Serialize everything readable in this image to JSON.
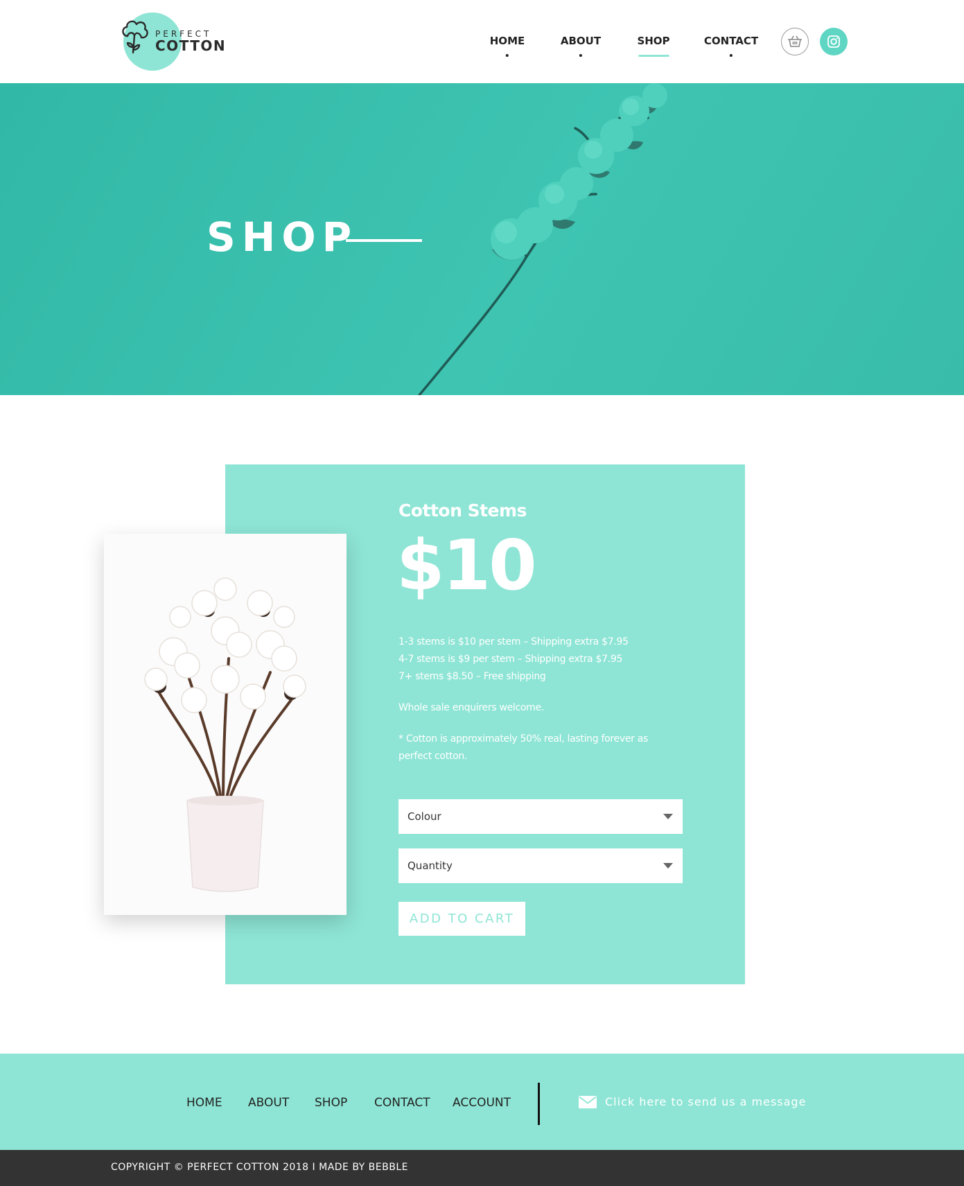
{
  "brand": {
    "name_top": "PERFECT",
    "name_bottom": "COTTON"
  },
  "nav": {
    "items": [
      {
        "label": "HOME"
      },
      {
        "label": "ABOUT"
      },
      {
        "label": "SHOP"
      },
      {
        "label": "CONTACT"
      }
    ],
    "active": "SHOP",
    "cart_icon": "basket-icon",
    "social_icon": "instagram-icon"
  },
  "hero": {
    "title": "SHOP"
  },
  "product": {
    "name": "Cotton Stems",
    "price": "$10",
    "pricing_lines": [
      "1-3 stems is $10 per stem – Shipping extra $7.95",
      "4-7 stems is $9 per stem – Shipping extra $7.95",
      "7+ stems $8.50 – Free shipping"
    ],
    "wholesale_note": "Whole sale enquirers welcome.",
    "disclaimer": "* Cotton is approximately 50% real, lasting forever as perfect cotton.",
    "colour_select": {
      "value": "Colour"
    },
    "quantity_select": {
      "value": "Quantity"
    },
    "add_to_cart_label": "ADD TO CART"
  },
  "footer": {
    "links": [
      {
        "label": "HOME"
      },
      {
        "label": "ABOUT"
      },
      {
        "label": "SHOP"
      },
      {
        "label": "CONTACT"
      },
      {
        "label": "ACCOUNT"
      }
    ],
    "message_icon": "envelope-icon",
    "message_text": "Click here to send us a message",
    "copyright": "COPYRIGHT © PERFECT COTTON 2018 I MADE BY BEBBLE"
  },
  "colors": {
    "accent": "#8ee5d5",
    "hero_teal": "#3bbfac",
    "dark_bar": "#333333"
  }
}
